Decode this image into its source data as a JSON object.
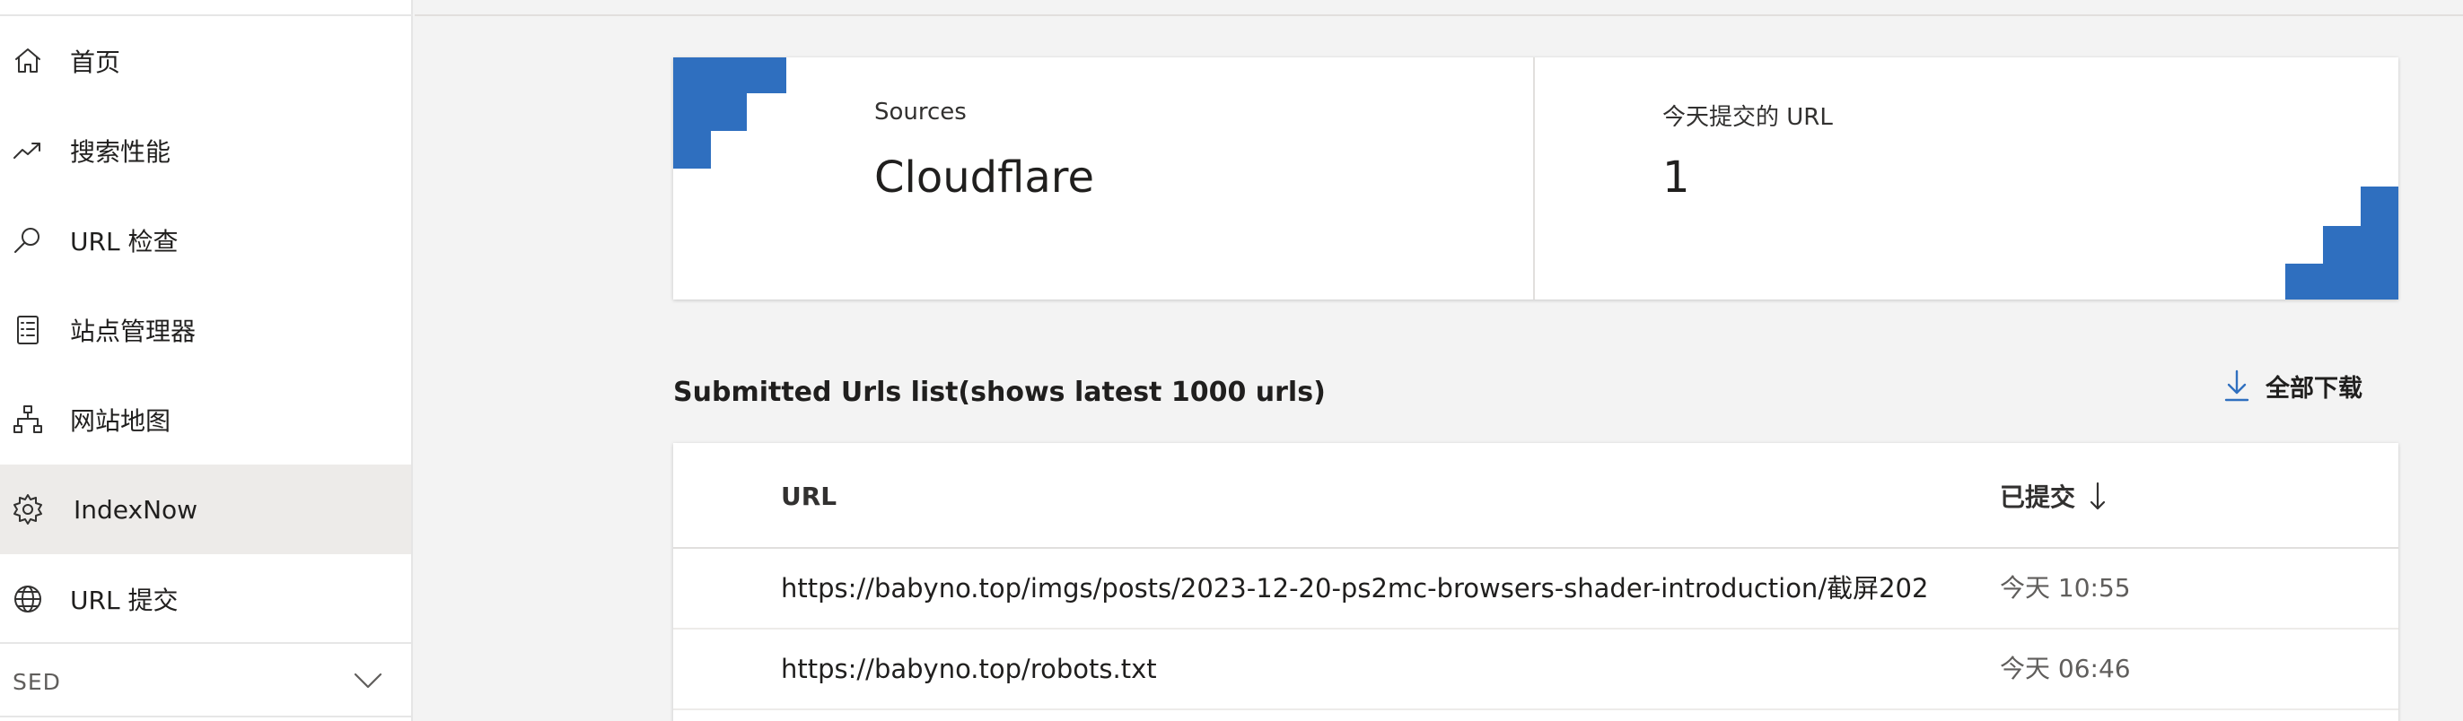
{
  "sidebar": {
    "items": [
      {
        "label": "首页",
        "icon": "home-icon"
      },
      {
        "label": "搜索性能",
        "icon": "trend-icon"
      },
      {
        "label": "URL 检查",
        "icon": "search-icon"
      },
      {
        "label": "站点管理器",
        "icon": "checklist-icon"
      },
      {
        "label": "网站地图",
        "icon": "sitemap-icon"
      },
      {
        "label": "IndexNow",
        "icon": "gear-icon",
        "active": true
      },
      {
        "label": "URL 提交",
        "icon": "globe-icon"
      }
    ],
    "section": {
      "label": "SED",
      "icon": "chevron-down-icon"
    }
  },
  "cards": {
    "sources": {
      "label": "Sources",
      "value": "Cloudflare"
    },
    "today": {
      "label": "今天提交的 URL",
      "value": "1"
    }
  },
  "list": {
    "title": "Submitted Urls list(shows latest 1000 urls)",
    "download_label": "全部下载",
    "columns": {
      "url": "URL",
      "submitted": "已提交"
    },
    "rows": [
      {
        "url": "https://babyno.top/imgs/posts/2023-12-20-ps2mc-browsers-shader-introduction/截屏202",
        "submitted": "今天 10:55"
      },
      {
        "url": "https://babyno.top/robots.txt",
        "submitted": "今天 06:46"
      }
    ]
  },
  "colors": {
    "accent": "#2f6fbf",
    "active_bg": "#edebe9",
    "page_bg": "#f3f3f3"
  }
}
